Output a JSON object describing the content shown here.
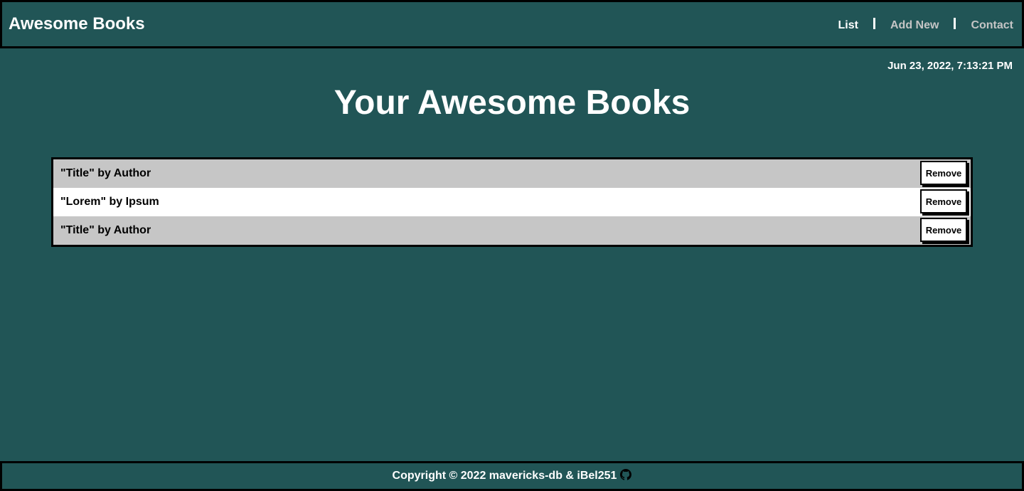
{
  "header": {
    "brand": "Awesome Books",
    "nav": [
      {
        "label": "List",
        "active": true
      },
      {
        "label": "Add New",
        "active": false
      },
      {
        "label": "Contact",
        "active": false
      }
    ]
  },
  "datetime": "Jun 23, 2022, 7:13:21 PM",
  "main": {
    "title": "Your Awesome Books",
    "books": [
      {
        "text": "\"Title\" by Author",
        "button": "Remove"
      },
      {
        "text": "\"Lorem\" by Ipsum",
        "button": "Remove"
      },
      {
        "text": "\"Title\" by Author",
        "button": "Remove"
      }
    ]
  },
  "footer": {
    "text": "Copyright © 2022 mavericks-db & iBel251",
    "icon": "github-icon"
  },
  "colors": {
    "background": "#215556",
    "row_alt": "#c6c6c6",
    "border": "#000000",
    "nav_inactive": "#c5c5c5"
  }
}
